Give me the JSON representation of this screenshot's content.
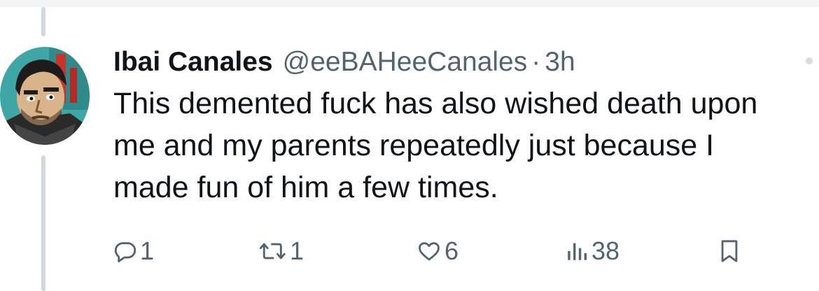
{
  "tweet": {
    "display_name": "Ibai Canales",
    "handle": "@eeBAHeeCanales",
    "separator": "·",
    "time": "3h",
    "text": "This demented fuck has also wished death upon me and my parents repeatedly just because I made fun of him a few times."
  },
  "actions": {
    "replies": "1",
    "retweets": "1",
    "likes": "6",
    "views": "38"
  },
  "icons": {
    "reply": "reply-icon",
    "retweet": "retweet-icon",
    "like": "heart-icon",
    "views": "views-icon",
    "bookmark": "bookmark-icon",
    "more": "more-icon"
  },
  "colors": {
    "text_primary": "#0f1419",
    "text_secondary": "#536471",
    "thread_line": "#cfd9de"
  }
}
